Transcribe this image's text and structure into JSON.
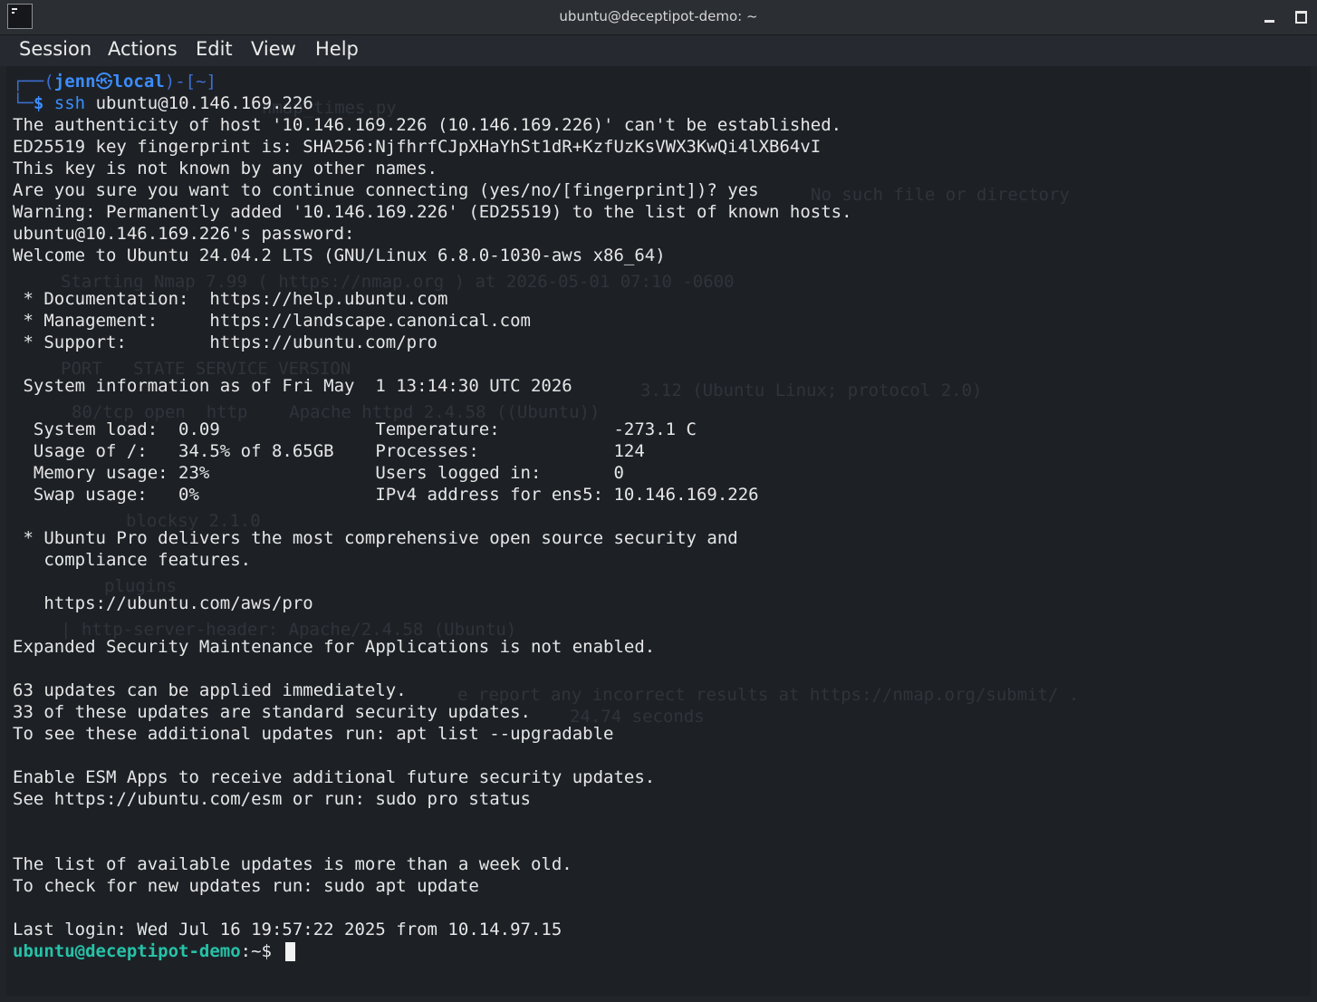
{
  "window": {
    "title": "ubuntu@deceptipot-demo: ~"
  },
  "menu": {
    "items": [
      "Session",
      "Actions",
      "Edit",
      "View",
      "Help"
    ]
  },
  "terminal": {
    "local_prompt": {
      "line1_prefix": "┌──(",
      "user": "jenn",
      "symbol": "㉿",
      "host": "local",
      "line1_suffix": ")-[~]",
      "line2_prefix": "└─",
      "dollar": "$",
      "command_name": "ssh",
      "command_args": " ubuntu@10.146.169.226"
    },
    "output": [
      "The authenticity of host '10.146.169.226 (10.146.169.226)' can't be established.",
      "ED25519 key fingerprint is: SHA256:NjfhrfCJpXHaYhSt1dR+KzfUzKsVWX3KwQi4lXB64vI",
      "This key is not known by any other names.",
      "Are you sure you want to continue connecting (yes/no/[fingerprint])? yes",
      "Warning: Permanently added '10.146.169.226' (ED25519) to the list of known hosts.",
      "ubuntu@10.146.169.226's password:",
      "Welcome to Ubuntu 24.04.2 LTS (GNU/Linux 6.8.0-1030-aws x86_64)",
      "",
      " * Documentation:  https://help.ubuntu.com",
      " * Management:     https://landscape.canonical.com",
      " * Support:        https://ubuntu.com/pro",
      "",
      " System information as of Fri May  1 13:14:30 UTC 2026",
      "",
      "  System load:  0.09               Temperature:           -273.1 C",
      "  Usage of /:   34.5% of 8.65GB    Processes:             124",
      "  Memory usage: 23%                Users logged in:       0",
      "  Swap usage:   0%                 IPv4 address for ens5: 10.146.169.226",
      "",
      " * Ubuntu Pro delivers the most comprehensive open source security and",
      "   compliance features.",
      "",
      "   https://ubuntu.com/aws/pro",
      "",
      "Expanded Security Maintenance for Applications is not enabled.",
      "",
      "63 updates can be applied immediately.",
      "33 of these updates are standard security updates.",
      "To see these additional updates run: apt list --upgradable",
      "",
      "Enable ESM Apps to receive additional future security updates.",
      "See https://ubuntu.com/esm or run: sudo pro status",
      "",
      "",
      "The list of available updates is more than a week old.",
      "To check for new updates run: sudo apt update",
      "",
      "Last login: Wed Jul 16 19:57:22 2025 from 10.14.97.15"
    ],
    "remote_prompt": {
      "user_host": "ubuntu@deceptipot-demo",
      "path_and_dollar": ":~$ "
    },
    "background_ghost_text": [
      "nmap_times.py",
      "No such file or directory",
      "Starting Nmap 7.99 ( https://nmap.org ) at 2026-05-01 07:10 -0600",
      "PORT   STATE SERVICE VERSION",
      "3.12 (Ubuntu Linux; protocol 2.0)",
      "80/tcp open  http    Apache httpd 2.4.58 ((Ubuntu))",
      "| http-server-header: Apache/2.4.58 (Ubuntu)",
      "e report any incorrect results at https://nmap.org/submit/ .",
      "24.74 seconds",
      "blocksy 2.1.0",
      "plugins"
    ]
  },
  "colors": {
    "terminal_bg": "#1d2126",
    "text": "#e6e6e6",
    "local_prompt": "#3c8dfb",
    "remote_prompt": "#26c2a8"
  }
}
